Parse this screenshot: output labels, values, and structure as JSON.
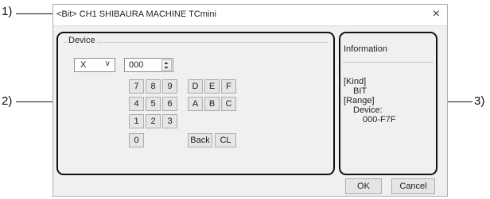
{
  "callouts": {
    "c1": "1)",
    "c2": "2)",
    "c3": "3)"
  },
  "dialog": {
    "title": "<Bit> CH1 SHIBAURA MACHINE TCmini",
    "close_glyph": "×"
  },
  "device": {
    "group_label": "Device",
    "device_type": "X",
    "dropdown_glyph": "∨",
    "address_value": "000"
  },
  "keypad": {
    "k7": "7",
    "k8": "8",
    "k9": "9",
    "k4": "4",
    "k5": "5",
    "k6": "6",
    "k1": "1",
    "k2": "2",
    "k3": "3",
    "k0": "0",
    "kD": "D",
    "kE": "E",
    "kF": "F",
    "kA": "A",
    "kB": "B",
    "kC": "C",
    "back": "Back",
    "clear": "CL"
  },
  "info": {
    "title": "Information",
    "kind_label": "[Kind]",
    "kind_value": "BIT",
    "range_label": "[Range]",
    "range_device_label": "Device:",
    "range_value": "000-F7F"
  },
  "buttons": {
    "ok": "OK",
    "cancel": "Cancel"
  },
  "icons": {
    "spin": "spin-buttons-icon",
    "close": "close-icon",
    "dropdown": "chevron-down-icon"
  }
}
